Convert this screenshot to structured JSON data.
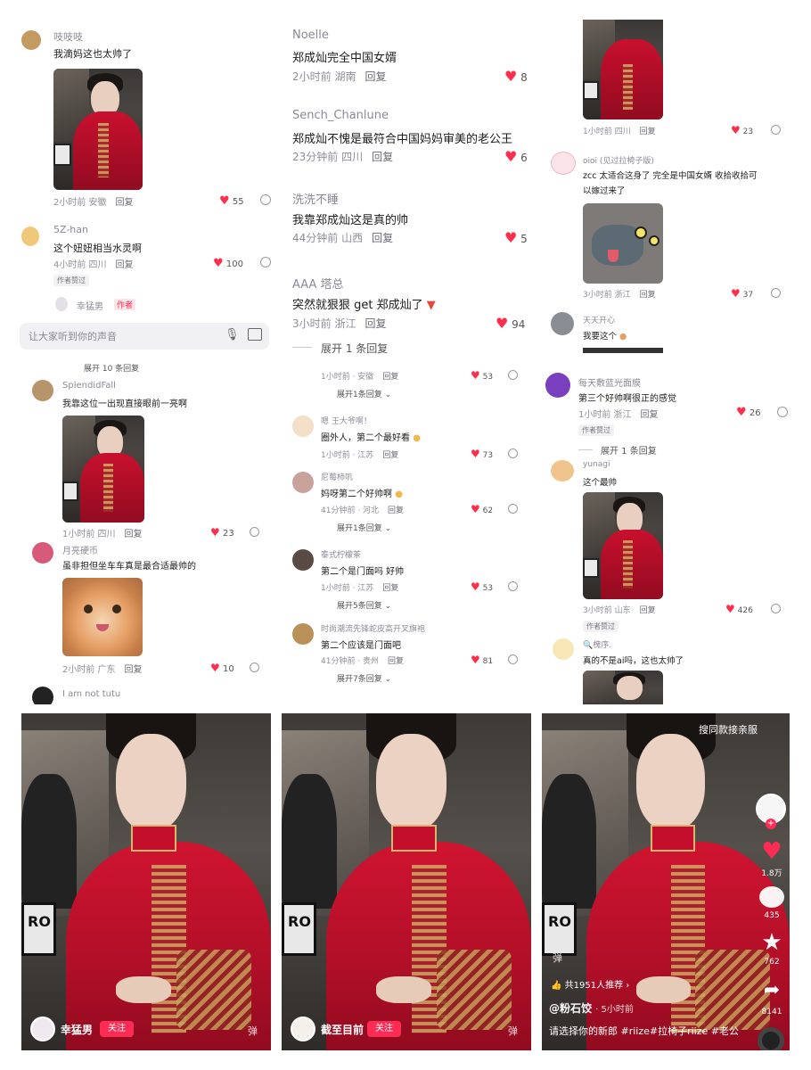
{
  "col1": {
    "c1": {
      "user": "吱吱吱",
      "text": "我滴妈这也太帅了",
      "meta_time": "2小时前 安徽",
      "reply": "回复",
      "likes": "55"
    },
    "c2": {
      "user": "5Z-han",
      "text": "这个妞妞相当水灵啊",
      "meta_time": "4小时前 四川",
      "reply": "回复",
      "likes": "100",
      "badge": "作者赞过",
      "author_reply_user": "幸猛男",
      "author_tag": "作者"
    },
    "input_placeholder": "让大家听到你的声音",
    "truncated_expand": "展开 10 条回复",
    "c3": {
      "user": "SplendidFall",
      "text": "我靠这位一出现直接眼前一亮啊",
      "meta_time": "1小时前 四川",
      "reply": "回复",
      "likes": "23"
    },
    "c4": {
      "user": "月亮硬币",
      "text": "虽非担但坐车车真是最合适最帅的",
      "meta_time": "2小时前 广东",
      "reply": "回复",
      "likes": "10"
    },
    "c5": {
      "user": "I am not tutu"
    }
  },
  "col2": {
    "c1": {
      "user": "Noelle",
      "text": "郑成灿完全中国女婿",
      "meta_time": "2小时前 湖南",
      "reply": "回复",
      "likes": "8"
    },
    "c2": {
      "user": "Sench_Chanlune",
      "text": "郑成灿不愧是最符合中国妈妈审美的老公王",
      "meta_time": "23分钟前 四川",
      "reply": "回复",
      "likes": "6"
    },
    "c3": {
      "user": "洗洗不睡",
      "text": "我靠郑成灿这是真的帅",
      "meta_time": "44分钟前 山西",
      "reply": "回复",
      "likes": "5"
    },
    "c4": {
      "user": "AAA 塔总",
      "text": "突然就狠狠 get 郑成灿了",
      "meta_time": "3小时前 浙江",
      "reply": "回复",
      "likes": "94",
      "expand": "展开 1 条回复"
    },
    "r0": {
      "meta_time": "1小时前 · 安徽",
      "reply": "回复",
      "likes": "53",
      "expand": "展开1条回复"
    },
    "r1": {
      "user": "嗯 王大爷啊！",
      "text": "圈外人，第二个最好看",
      "meta_time": "1小时前 · 江苏",
      "reply": "回复",
      "likes": "73"
    },
    "r2": {
      "user": "尼莓柿叽",
      "text": "妈呀第二个好帅啊",
      "meta_time": "41分钟前 · 河北",
      "reply": "回复",
      "likes": "62",
      "expand": "展开1条回复"
    },
    "r3": {
      "user": "泰式柠檬茶",
      "text": "第二个是门面吗 好帅",
      "meta_time": "1小时前 · 江苏",
      "reply": "回复",
      "likes": "53",
      "expand": "展开5条回复"
    },
    "r4": {
      "user": "时尚潮流先锋蛇皮高开叉旗袍",
      "text": "第二个应该是门面吧",
      "meta_time": "41分钟前 · 贵州",
      "reply": "回复",
      "likes": "81",
      "expand": "展开7条回复"
    }
  },
  "col3": {
    "c0": {
      "meta_time": "1小时前 四川",
      "reply": "回复",
      "likes": "23"
    },
    "c1": {
      "user": "oioi (见过拉椅子版)",
      "text_line1": "zcc 太适合这身了 完全是中国女婿 收拾收拾可",
      "text_line2": "以嫁过来了",
      "meta_time": "3小时前 浙江",
      "reply": "回复",
      "likes": "37"
    },
    "c2": {
      "user": "天天开心",
      "text": "我要这个"
    },
    "c3": {
      "user": "每天敷蓝光面膜",
      "text": "第三个好帅啊很正的感觉",
      "meta_time": "1小时前 浙江",
      "reply": "回复",
      "likes": "26",
      "badge": "作者赞过",
      "expand": "展开 1 条回复"
    },
    "c4": {
      "user": "yunagi",
      "text": "这个最帅",
      "meta_time": "3小时前 山东",
      "reply": "回复",
      "likes": "426",
      "badge": "作者赞过"
    },
    "c5": {
      "user": "槐序.",
      "text": "真的不是ai吗，这也太帅了"
    }
  },
  "bottom": {
    "p1": {
      "user": "幸猛男",
      "follow": "关注",
      "watermark": "弹"
    },
    "p2": {
      "user": "截至目前",
      "follow": "关注",
      "watermark": "弹"
    },
    "p3": {
      "top_right_text": "搜同款接亲服",
      "like_count": "1.8万",
      "comment_count": "435",
      "star_count": "762",
      "share_count": "8141",
      "recommend": "共1951人推荐",
      "author": "@粉石饺",
      "time": "· 5小时前",
      "caption": "请选择你的新郎 #riize#拉椅子riize #老公",
      "watermark": "弹"
    }
  },
  "colors": {
    "heart": "#ff2e4d",
    "follow_btn": "#fe2c55",
    "author_tag": "#fe2c55"
  }
}
